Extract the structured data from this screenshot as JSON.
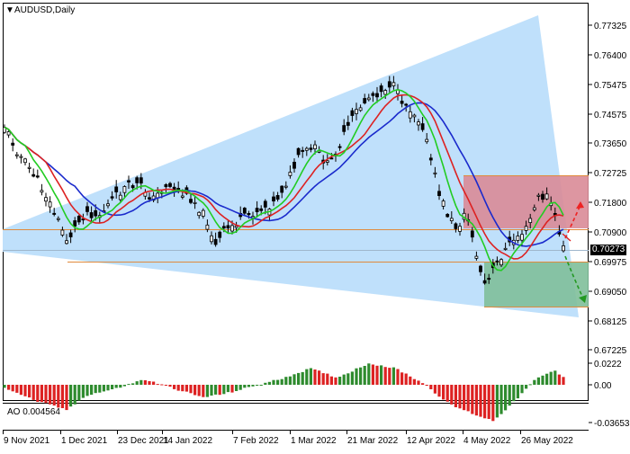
{
  "header": {
    "symbol_label": "AUDUSD,Daily",
    "menu_glyph": "▼"
  },
  "price_axis": {
    "ticks": [
      "0.77325",
      "0.76400",
      "0.75475",
      "0.74575",
      "0.73650",
      "0.72725",
      "0.71800",
      "0.70900",
      "0.69975",
      "0.69050",
      "0.68125",
      "0.67225"
    ],
    "current_price": "0.70273",
    "current_price_color": "#000000"
  },
  "time_axis": {
    "labels": [
      "9 Nov 2021",
      "1 Dec 2021",
      "23 Dec 2021",
      "14 Jan 2022",
      "7 Feb 2022",
      "1 Mar 2022",
      "21 Mar 2022",
      "12 Apr 2022",
      "4 May 2022",
      "26 May 2022"
    ]
  },
  "oscillator": {
    "label": "AO 0.004564",
    "ticks": [
      "0.0222",
      "0.00",
      "-0.036533"
    ]
  },
  "colors": {
    "triangle_fill": "#bfe0fb",
    "red_zone": "#d98b97",
    "green_zone": "#7fbf9a",
    "level_line": "#e08a3c",
    "ma_fast": "#22cc22",
    "ma_mid": "#dd2222",
    "ma_slow": "#1a2acc",
    "ao_up": "#2e8b2e",
    "ao_down": "#dd2222",
    "arrow_up": "#ee2222",
    "arrow_down": "#229922"
  },
  "icons": {
    "menu": "dropdown-triangle-icon"
  },
  "chart_data": {
    "type": "candlestick",
    "symbol": "AUDUSD",
    "timeframe": "Daily",
    "y_range": [
      0.6675,
      0.777
    ],
    "current_price": 0.70273,
    "x_tick_labels": [
      "9 Nov 2021",
      "1 Dec 2021",
      "23 Dec 2021",
      "14 Jan 2022",
      "7 Feb 2022",
      "1 Mar 2022",
      "21 Mar 2022",
      "12 Apr 2022",
      "4 May 2022",
      "26 May 2022"
    ],
    "resistance_level": 0.7095,
    "support_level": 0.6998,
    "ao_value": 0.004564,
    "ao_range": [
      -0.036533,
      0.0222
    ]
  }
}
